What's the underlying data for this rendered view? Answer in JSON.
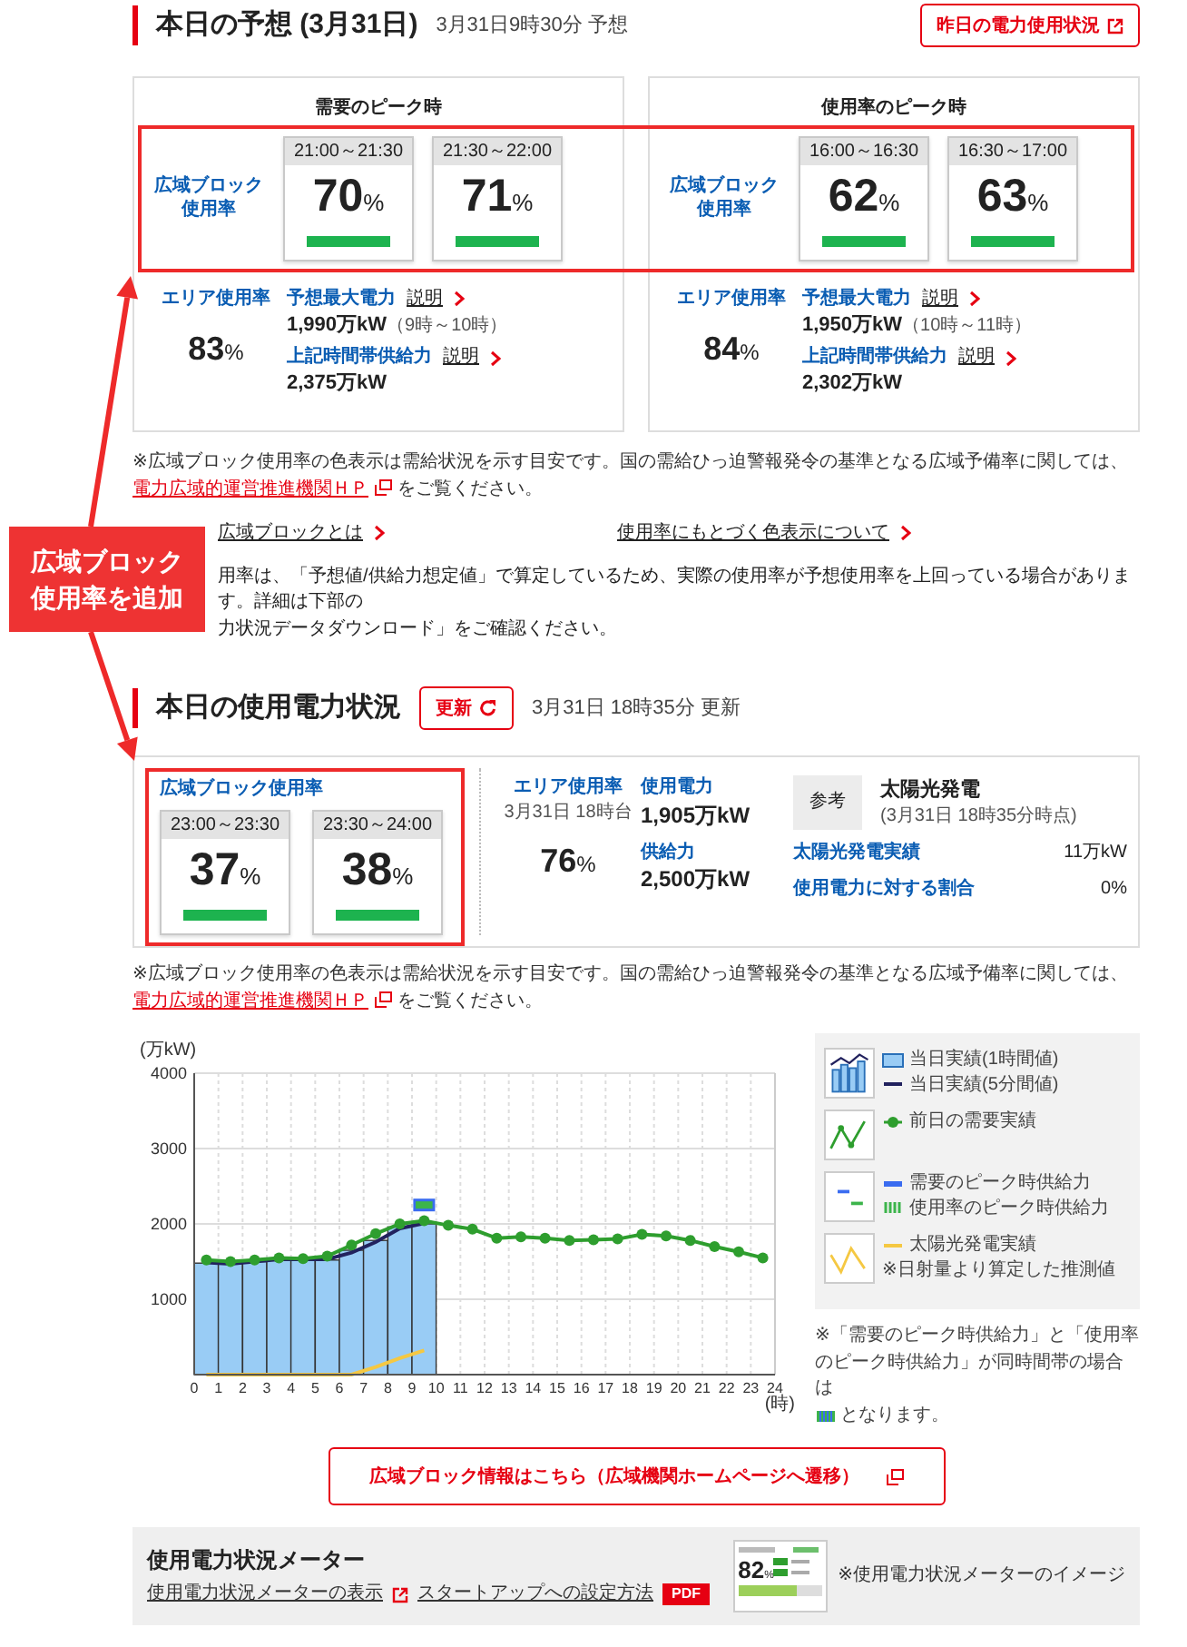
{
  "forecast": {
    "title": "本日の予想 (3月31日)",
    "timestamp": "3月31日9時30分 予想",
    "history_button": "昨日の電力使用状況",
    "cards": [
      {
        "heading": "需要のピーク時",
        "block_label": "広域ブロック使用率",
        "tiles": [
          {
            "time": "21:00～21:30",
            "value": "70",
            "unit": "%",
            "color": "#1db34f"
          },
          {
            "time": "21:30～22:00",
            "value": "71",
            "unit": "%",
            "color": "#1db34f"
          }
        ],
        "area_label": "エリア使用率",
        "area_value": "83",
        "area_unit": "%",
        "items": [
          {
            "label": "予想最大電力",
            "help": "説明",
            "value": "1,990万kW",
            "note": "（9時～10時）"
          },
          {
            "label": "上記時間帯供給力",
            "help": "説明",
            "value": "2,375万kW"
          }
        ]
      },
      {
        "heading": "使用率のピーク時",
        "block_label": "広域ブロック使用率",
        "tiles": [
          {
            "time": "16:00～16:30",
            "value": "62",
            "unit": "%",
            "color": "#1db34f"
          },
          {
            "time": "16:30～17:00",
            "value": "63",
            "unit": "%",
            "color": "#1db34f"
          }
        ],
        "area_label": "エリア使用率",
        "area_value": "84",
        "area_unit": "%",
        "items": [
          {
            "label": "予想最大電力",
            "help": "説明",
            "value": "1,950万kW",
            "note": "（10時～11時）"
          },
          {
            "label": "上記時間帯供給力",
            "help": "説明",
            "value": "2,302万kW"
          }
        ]
      }
    ],
    "note": {
      "text": "※広域ブロック使用率の色表示は需給状況を示す目安です。国の需給ひっ迫警報発令の基準となる広域予備率に関しては、",
      "link": "電力広域的運営推進機関ＨＰ",
      "after": " をご覧ください。"
    },
    "links": [
      "広域ブロックとは",
      "使用率にもとづく色表示について"
    ],
    "paragraph": [
      "用率は、「予想値/供給力想定値」で算定しているため、実際の使用率が予想使用率を上回っている場合があります。詳細は下部の",
      "力状況データダウンロード」をご確認ください。"
    ]
  },
  "usage": {
    "title": "本日の使用電力状況",
    "refresh_button": "更新",
    "timestamp": "3月31日 18時35分 更新",
    "block_label": "広域ブロック使用率",
    "tiles": [
      {
        "time": "23:00～23:30",
        "value": "37",
        "unit": "%",
        "color": "#1db34f"
      },
      {
        "time": "23:30～24:00",
        "value": "38",
        "unit": "%",
        "color": "#1db34f"
      }
    ],
    "area": {
      "label": "エリア使用率",
      "time": "3月31日 18時台",
      "value": "76",
      "unit": "%"
    },
    "power": [
      {
        "label": "使用電力",
        "value": "1,905万kW"
      },
      {
        "label": "供給力",
        "value": "2,500万kW"
      }
    ],
    "solar": {
      "badge": "参考",
      "title": "太陽光発電",
      "time": "(3月31日 18時35分時点)",
      "rows": [
        {
          "label": "太陽光発電実績",
          "value": "11万kW"
        },
        {
          "label": "使用電力に対する割合",
          "value": "0%"
        }
      ]
    },
    "note": {
      "text": "※広域ブロック使用率の色表示は需給状況を示す目安です。国の需給ひっ迫警報発令の基準となる広域予備率に関しては、",
      "link": "電力広域的運営推進機関ＨＰ",
      "after": " をご覧ください。"
    }
  },
  "chart": {
    "chart_data": {
      "type": "bar",
      "ylabel": "(万kW)",
      "xlabel": "(時)",
      "x": [
        0.5,
        1.5,
        2.5,
        3.5,
        4.5,
        5.5,
        6.5,
        7.5,
        8.5,
        9.5,
        10.5,
        11.5,
        12.5,
        13.5,
        14.5,
        15.5,
        16.5,
        17.5,
        18.5,
        19.5,
        20.5,
        21.5,
        22.5,
        23.5
      ],
      "xlim": [
        0,
        24
      ],
      "ylim": [
        0,
        4000
      ],
      "grid": true,
      "xticks": [
        0,
        1,
        2,
        3,
        4,
        5,
        6,
        7,
        8,
        9,
        10,
        11,
        12,
        13,
        14,
        15,
        16,
        17,
        18,
        19,
        20,
        21,
        22,
        23,
        24
      ],
      "yticks": [
        1000,
        2000,
        3000,
        4000
      ],
      "series": [
        {
          "name": "当日実績(1時間値)",
          "color": "#99ccf5",
          "values": [
            1480,
            1470,
            1500,
            1530,
            1530,
            1520,
            1650,
            1780,
            1960,
            2000,
            null,
            null,
            null,
            null,
            null,
            null,
            null,
            null,
            null,
            null,
            null,
            null,
            null,
            null
          ]
        },
        {
          "name": "当日実績(5分間値)",
          "type": "line",
          "color": "#22225e",
          "values": [
            1490,
            1470,
            1500,
            1530,
            1530,
            1530,
            1620,
            1760,
            1940,
            2010,
            null,
            null,
            null,
            null,
            null,
            null,
            null,
            null,
            null,
            null,
            null,
            null,
            null,
            null
          ]
        },
        {
          "name": "前日の需要実績",
          "type": "line",
          "marker": true,
          "color": "#2e9e2e",
          "values": [
            1520,
            1500,
            1520,
            1550,
            1540,
            1570,
            1720,
            1870,
            2000,
            2040,
            1980,
            1930,
            1810,
            1830,
            1810,
            1780,
            1790,
            1800,
            1860,
            1840,
            1780,
            1700,
            1630,
            1550
          ]
        },
        {
          "name": "需要のピーク時供給力",
          "type": "scatter",
          "color": "#3a6cf0",
          "values": [
            null,
            null,
            null,
            null,
            null,
            null,
            null,
            null,
            null,
            2250,
            null,
            null,
            null,
            null,
            null,
            null,
            null,
            null,
            null,
            null,
            null,
            null,
            null,
            null
          ]
        },
        {
          "name": "使用率のピーク時供給力",
          "type": "scatter",
          "color": "#3cb44b",
          "values": [
            null,
            null,
            null,
            null,
            null,
            null,
            null,
            null,
            null,
            2250,
            null,
            null,
            null,
            null,
            null,
            null,
            null,
            null,
            null,
            null,
            null,
            null,
            null,
            null
          ]
        },
        {
          "name": "太陽光発電実績",
          "type": "line",
          "color": "#f5c842",
          "values": [
            0,
            0,
            0,
            0,
            0,
            0,
            0,
            100,
            220,
            320,
            null,
            null,
            null,
            null,
            null,
            null,
            null,
            null,
            null,
            null,
            null,
            null,
            null,
            null
          ]
        }
      ]
    },
    "solar_note": "※日射量より算定した推測値",
    "legend_note": {
      "before": "※「需要のピーク時供給力」と「使用率のピーク時供給力」が同時間帯の場合は",
      "after": "となります。"
    }
  },
  "site_button": "広域ブロック情報はこちら（広域機関ホームページへ遷移）",
  "meter": {
    "title": "使用電力状況メーター",
    "display_link": "使用電力状況メーターの表示",
    "setup_link": "スタートアップへの設定方法",
    "pdf_badge": "PDF",
    "thumbnail_value": "82",
    "thumbnail_unit": "%",
    "caption": "※使用電力状況メーターのイメージ"
  },
  "annotation": {
    "callout": "広域ブロック使用率を追加"
  }
}
